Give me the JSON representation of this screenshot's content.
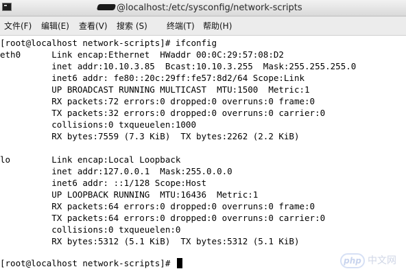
{
  "window": {
    "title": "@localhost:/etc/sysconfig/network-scripts"
  },
  "menu": {
    "items": [
      "文件(F)",
      "编辑(E)",
      "查看(V)",
      "搜索 (S)",
      "终端(T)",
      "帮助(H)"
    ]
  },
  "terminal": {
    "lines": [
      "[root@localhost network-scripts]# ifconfig",
      "eth0      Link encap:Ethernet  HWaddr 00:0C:29:57:08:D2",
      "          inet addr:10.10.3.85  Bcast:10.10.3.255  Mask:255.255.255.0",
      "          inet6 addr: fe80::20c:29ff:fe57:8d2/64 Scope:Link",
      "          UP BROADCAST RUNNING MULTICAST  MTU:1500  Metric:1",
      "          RX packets:72 errors:0 dropped:0 overruns:0 frame:0",
      "          TX packets:32 errors:0 dropped:0 overruns:0 carrier:0",
      "          collisions:0 txqueuelen:1000",
      "          RX bytes:7559 (7.3 KiB)  TX bytes:2262 (2.2 KiB)",
      "",
      "lo        Link encap:Local Loopback",
      "          inet addr:127.0.0.1  Mask:255.0.0.0",
      "          inet6 addr: ::1/128 Scope:Host",
      "          UP LOOPBACK RUNNING  MTU:16436  Metric:1",
      "          RX packets:64 errors:0 dropped:0 overruns:0 frame:0",
      "          TX packets:64 errors:0 dropped:0 overruns:0 carrier:0",
      "          collisions:0 txqueuelen:0",
      "          RX bytes:5312 (5.1 KiB)  TX bytes:5312 (5.1 KiB)",
      "",
      "[root@localhost network-scripts]# "
    ]
  },
  "watermark": {
    "logo": "php",
    "text": "中文网"
  }
}
